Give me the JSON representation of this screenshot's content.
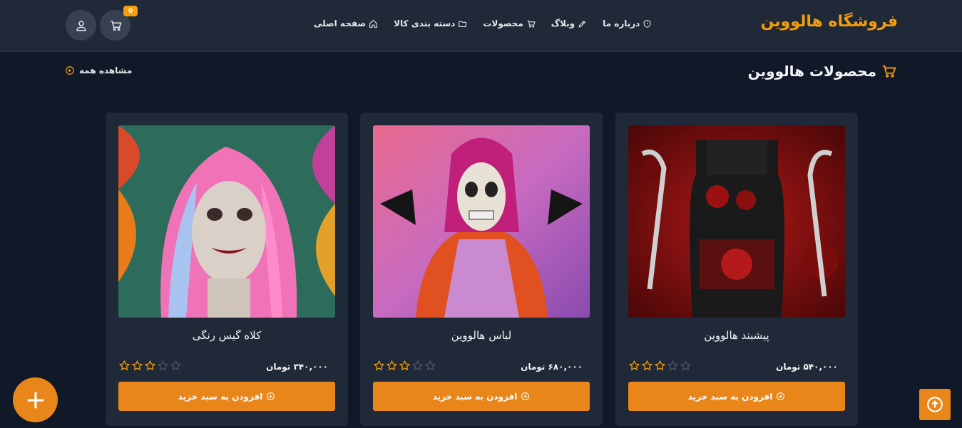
{
  "header": {
    "logo": "فروشگاه هالووین",
    "cart_count": "0",
    "nav": [
      {
        "label": "صفحه اصلی",
        "icon": "home-icon"
      },
      {
        "label": "دسته بندی کالا",
        "icon": "folder-icon"
      },
      {
        "label": "محصولات",
        "icon": "cart-icon"
      },
      {
        "label": "وبلاگ",
        "icon": "pen-icon"
      },
      {
        "label": "درباره ما",
        "icon": "shield-icon"
      }
    ]
  },
  "section": {
    "title": "محصولات هالووین",
    "view_all": "مشاهده همه"
  },
  "products": [
    {
      "name": "پیشبند هالووین",
      "price": "۵۴۰,۰۰۰ تومان",
      "rating": 3,
      "max_rating": 5,
      "button": "افزودن به سبد خرید"
    },
    {
      "name": "لباس هالووین",
      "price": "۶۸۰,۰۰۰ تومان",
      "rating": 3,
      "max_rating": 5,
      "button": "افزودن به سبد خرید"
    },
    {
      "name": "کلاه گیس رنگی",
      "price": "۳۴۰,۰۰۰ تومان",
      "rating": 3,
      "max_rating": 5,
      "button": "افزودن به سبد خرید"
    }
  ],
  "colors": {
    "accent": "#e8861a",
    "background": "#111827",
    "surface": "#1f2937"
  }
}
